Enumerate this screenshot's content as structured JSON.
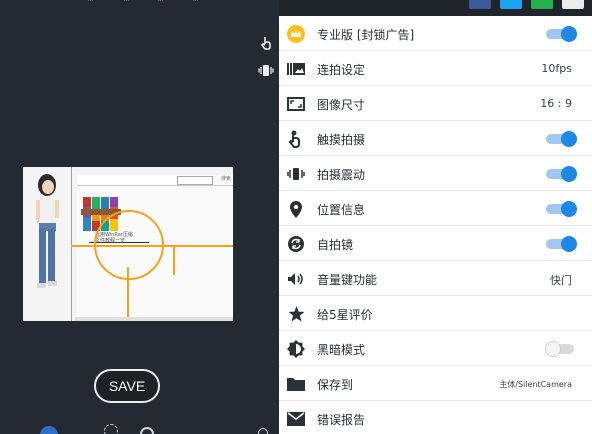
{
  "left_panel": {
    "top_labels": [
      "...",
      "...",
      "...",
      "..."
    ],
    "side_icons": [
      "touch-icon",
      "vibrate-icon"
    ],
    "preview": {
      "toolbar_text": "搜索",
      "caption_line1": "运用WinRar压缩",
      "caption_line2": "文件教程一览"
    },
    "save_label": "SAVE"
  },
  "settings": {
    "rows": [
      {
        "label": "专业版 [封锁广告]",
        "icon": "crown-icon",
        "toggle": true
      },
      {
        "label": "连拍设定",
        "icon": "burst-icon",
        "value": "10fps"
      },
      {
        "label": "图像尺寸",
        "icon": "aspect-ratio-icon",
        "value": "16 : 9"
      },
      {
        "label": "触摸拍摄",
        "icon": "touch-icon",
        "toggle": true
      },
      {
        "label": "拍摄震动",
        "icon": "vibrate-icon",
        "toggle": true
      },
      {
        "label": "位置信息",
        "icon": "location-icon",
        "toggle": true
      },
      {
        "label": "自拍镜",
        "icon": "switch-camera-icon",
        "toggle": true
      },
      {
        "label": "音量键功能",
        "icon": "volume-icon",
        "value": "快门"
      },
      {
        "label": "给5星评价",
        "icon": "star-icon"
      },
      {
        "label": "黑暗模式",
        "icon": "dark-mode-icon",
        "toggle": false
      },
      {
        "label": "保存到",
        "icon": "folder-icon",
        "value": "主体/SilentCamera"
      },
      {
        "label": "错误报告",
        "icon": "mail-icon"
      }
    ]
  },
  "colors": {
    "accent": "#1e88e5",
    "crown": "#f7c21b",
    "dark_bg": "#232a31",
    "focus_ring": "#f3a21b"
  }
}
